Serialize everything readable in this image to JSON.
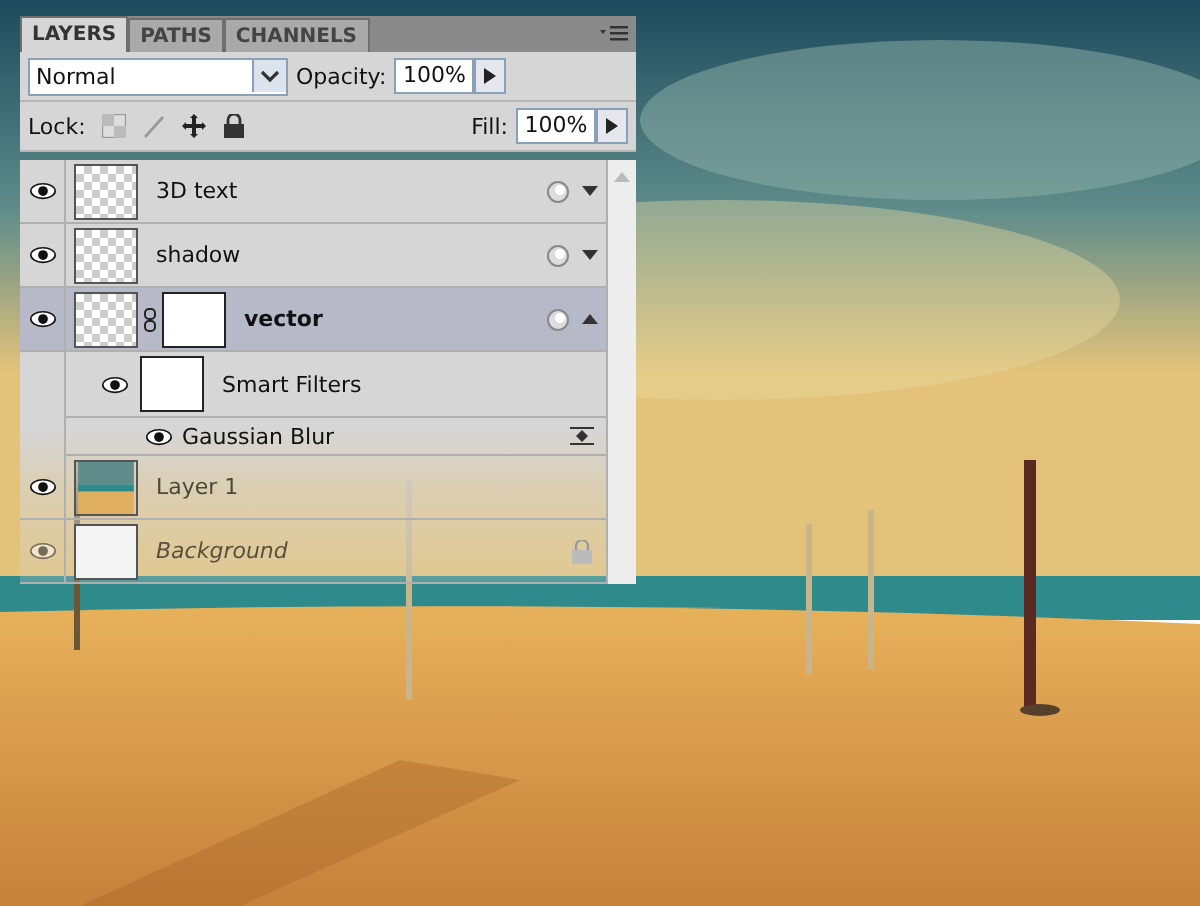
{
  "tabs": [
    {
      "label": "LAYERS",
      "selected": true
    },
    {
      "label": "PATHS",
      "selected": false
    },
    {
      "label": "CHANNELS",
      "selected": false
    }
  ],
  "blend_mode": {
    "value": "Normal"
  },
  "opacity": {
    "label": "Opacity:",
    "value": "100%"
  },
  "lock": {
    "label": "Lock:"
  },
  "fill": {
    "label": "Fill:",
    "value": "100%"
  },
  "layers": [
    {
      "kind": "smart",
      "name": "3D text",
      "visible": true,
      "selected": false,
      "expanded": false,
      "mask": false
    },
    {
      "kind": "smart",
      "name": "shadow",
      "visible": true,
      "selected": false,
      "expanded": false,
      "mask": false
    },
    {
      "kind": "smart",
      "name": "vector",
      "visible": true,
      "selected": true,
      "expanded": true,
      "mask": true
    },
    {
      "kind": "smart-filters",
      "name": "Smart Filters",
      "visible": true,
      "selected": false
    },
    {
      "kind": "filter",
      "name": "Gaussian Blur",
      "visible": true,
      "selected": false
    },
    {
      "name": "Layer 1",
      "visible": true,
      "selected": false
    },
    {
      "kind": "background",
      "name": "Background",
      "visible": true,
      "selected": false
    }
  ]
}
